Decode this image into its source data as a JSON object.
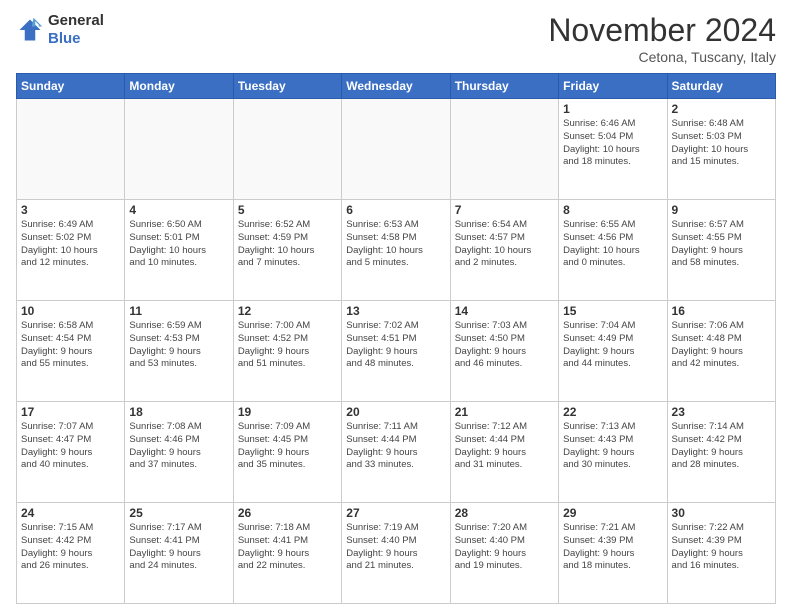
{
  "logo": {
    "line1": "General",
    "line2": "Blue"
  },
  "title": "November 2024",
  "location": "Cetona, Tuscany, Italy",
  "weekdays": [
    "Sunday",
    "Monday",
    "Tuesday",
    "Wednesday",
    "Thursday",
    "Friday",
    "Saturday"
  ],
  "weeks": [
    [
      {
        "day": "",
        "info": ""
      },
      {
        "day": "",
        "info": ""
      },
      {
        "day": "",
        "info": ""
      },
      {
        "day": "",
        "info": ""
      },
      {
        "day": "",
        "info": ""
      },
      {
        "day": "1",
        "info": "Sunrise: 6:46 AM\nSunset: 5:04 PM\nDaylight: 10 hours\nand 18 minutes."
      },
      {
        "day": "2",
        "info": "Sunrise: 6:48 AM\nSunset: 5:03 PM\nDaylight: 10 hours\nand 15 minutes."
      }
    ],
    [
      {
        "day": "3",
        "info": "Sunrise: 6:49 AM\nSunset: 5:02 PM\nDaylight: 10 hours\nand 12 minutes."
      },
      {
        "day": "4",
        "info": "Sunrise: 6:50 AM\nSunset: 5:01 PM\nDaylight: 10 hours\nand 10 minutes."
      },
      {
        "day": "5",
        "info": "Sunrise: 6:52 AM\nSunset: 4:59 PM\nDaylight: 10 hours\nand 7 minutes."
      },
      {
        "day": "6",
        "info": "Sunrise: 6:53 AM\nSunset: 4:58 PM\nDaylight: 10 hours\nand 5 minutes."
      },
      {
        "day": "7",
        "info": "Sunrise: 6:54 AM\nSunset: 4:57 PM\nDaylight: 10 hours\nand 2 minutes."
      },
      {
        "day": "8",
        "info": "Sunrise: 6:55 AM\nSunset: 4:56 PM\nDaylight: 10 hours\nand 0 minutes."
      },
      {
        "day": "9",
        "info": "Sunrise: 6:57 AM\nSunset: 4:55 PM\nDaylight: 9 hours\nand 58 minutes."
      }
    ],
    [
      {
        "day": "10",
        "info": "Sunrise: 6:58 AM\nSunset: 4:54 PM\nDaylight: 9 hours\nand 55 minutes."
      },
      {
        "day": "11",
        "info": "Sunrise: 6:59 AM\nSunset: 4:53 PM\nDaylight: 9 hours\nand 53 minutes."
      },
      {
        "day": "12",
        "info": "Sunrise: 7:00 AM\nSunset: 4:52 PM\nDaylight: 9 hours\nand 51 minutes."
      },
      {
        "day": "13",
        "info": "Sunrise: 7:02 AM\nSunset: 4:51 PM\nDaylight: 9 hours\nand 48 minutes."
      },
      {
        "day": "14",
        "info": "Sunrise: 7:03 AM\nSunset: 4:50 PM\nDaylight: 9 hours\nand 46 minutes."
      },
      {
        "day": "15",
        "info": "Sunrise: 7:04 AM\nSunset: 4:49 PM\nDaylight: 9 hours\nand 44 minutes."
      },
      {
        "day": "16",
        "info": "Sunrise: 7:06 AM\nSunset: 4:48 PM\nDaylight: 9 hours\nand 42 minutes."
      }
    ],
    [
      {
        "day": "17",
        "info": "Sunrise: 7:07 AM\nSunset: 4:47 PM\nDaylight: 9 hours\nand 40 minutes."
      },
      {
        "day": "18",
        "info": "Sunrise: 7:08 AM\nSunset: 4:46 PM\nDaylight: 9 hours\nand 37 minutes."
      },
      {
        "day": "19",
        "info": "Sunrise: 7:09 AM\nSunset: 4:45 PM\nDaylight: 9 hours\nand 35 minutes."
      },
      {
        "day": "20",
        "info": "Sunrise: 7:11 AM\nSunset: 4:44 PM\nDaylight: 9 hours\nand 33 minutes."
      },
      {
        "day": "21",
        "info": "Sunrise: 7:12 AM\nSunset: 4:44 PM\nDaylight: 9 hours\nand 31 minutes."
      },
      {
        "day": "22",
        "info": "Sunrise: 7:13 AM\nSunset: 4:43 PM\nDaylight: 9 hours\nand 30 minutes."
      },
      {
        "day": "23",
        "info": "Sunrise: 7:14 AM\nSunset: 4:42 PM\nDaylight: 9 hours\nand 28 minutes."
      }
    ],
    [
      {
        "day": "24",
        "info": "Sunrise: 7:15 AM\nSunset: 4:42 PM\nDaylight: 9 hours\nand 26 minutes."
      },
      {
        "day": "25",
        "info": "Sunrise: 7:17 AM\nSunset: 4:41 PM\nDaylight: 9 hours\nand 24 minutes."
      },
      {
        "day": "26",
        "info": "Sunrise: 7:18 AM\nSunset: 4:41 PM\nDaylight: 9 hours\nand 22 minutes."
      },
      {
        "day": "27",
        "info": "Sunrise: 7:19 AM\nSunset: 4:40 PM\nDaylight: 9 hours\nand 21 minutes."
      },
      {
        "day": "28",
        "info": "Sunrise: 7:20 AM\nSunset: 4:40 PM\nDaylight: 9 hours\nand 19 minutes."
      },
      {
        "day": "29",
        "info": "Sunrise: 7:21 AM\nSunset: 4:39 PM\nDaylight: 9 hours\nand 18 minutes."
      },
      {
        "day": "30",
        "info": "Sunrise: 7:22 AM\nSunset: 4:39 PM\nDaylight: 9 hours\nand 16 minutes."
      }
    ]
  ]
}
